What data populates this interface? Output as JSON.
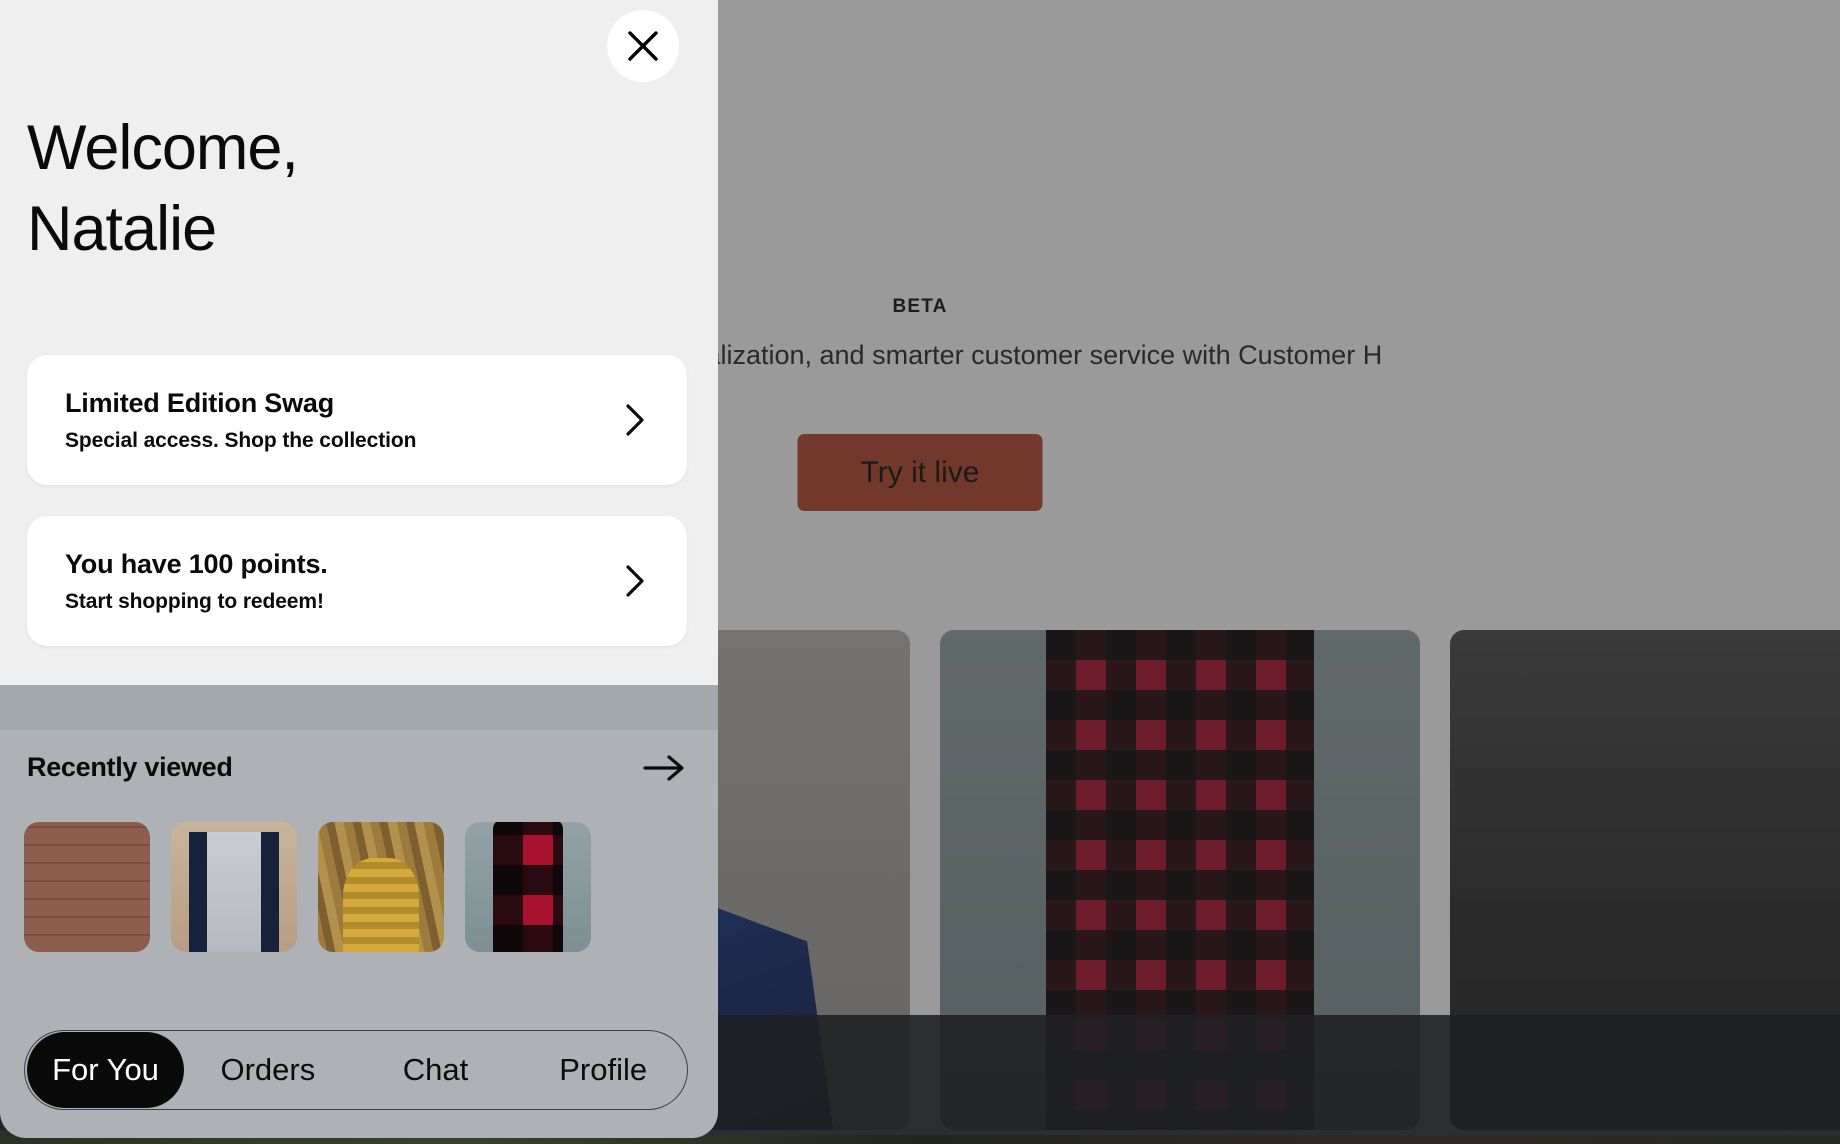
{
  "background": {
    "badge": "BETA",
    "tagline": "engagement, personalization, and smarter customer service with Customer H",
    "cta_label": "Try it live",
    "cta_color": "#b4472f",
    "product_cards": [
      {
        "name": "brick-wall-product-card",
        "style": "ph-brick"
      },
      {
        "name": "blue-tuxedo-product-card",
        "style": "ph-tux"
      },
      {
        "name": "red-plaid-shirt-product-card",
        "style": "ph-plaid-card"
      },
      {
        "name": "dark-product-card",
        "style": "ph-dark"
      }
    ]
  },
  "panel": {
    "close_icon": "close-icon",
    "greeting": "Welcome,\nNatalie",
    "promos": [
      {
        "title": "Limited Edition Swag",
        "subtitle": "Special access. Shop the collection",
        "chevron": "chevron-right-icon"
      },
      {
        "title": "You have 100 points.",
        "subtitle": "Start shopping to redeem!",
        "chevron": "chevron-right-icon"
      }
    ],
    "recently_viewed": {
      "title": "Recently viewed",
      "arrow_icon": "arrow-right-icon",
      "thumbnails": [
        {
          "name": "leather-bag-thumbnail",
          "style": "ph-brick"
        },
        {
          "name": "varsity-jacket-thumbnail",
          "style": "ph-varsity"
        },
        {
          "name": "camera-knit-hat-thumbnail",
          "style": "ph-corn"
        },
        {
          "name": "red-plaid-flannel-thumbnail",
          "style": "ph-plaid-card"
        }
      ]
    },
    "tabs": [
      {
        "label": "For You",
        "active": true
      },
      {
        "label": "Orders",
        "active": false
      },
      {
        "label": "Chat",
        "active": false
      },
      {
        "label": "Profile",
        "active": false
      }
    ]
  },
  "colors": {
    "panel_top": "#efefef",
    "panel_mid": "#a3a8ac",
    "panel_bottom": "#aeb2b6",
    "active_tab": "#0a0a0a",
    "accent": "#b4472f"
  }
}
